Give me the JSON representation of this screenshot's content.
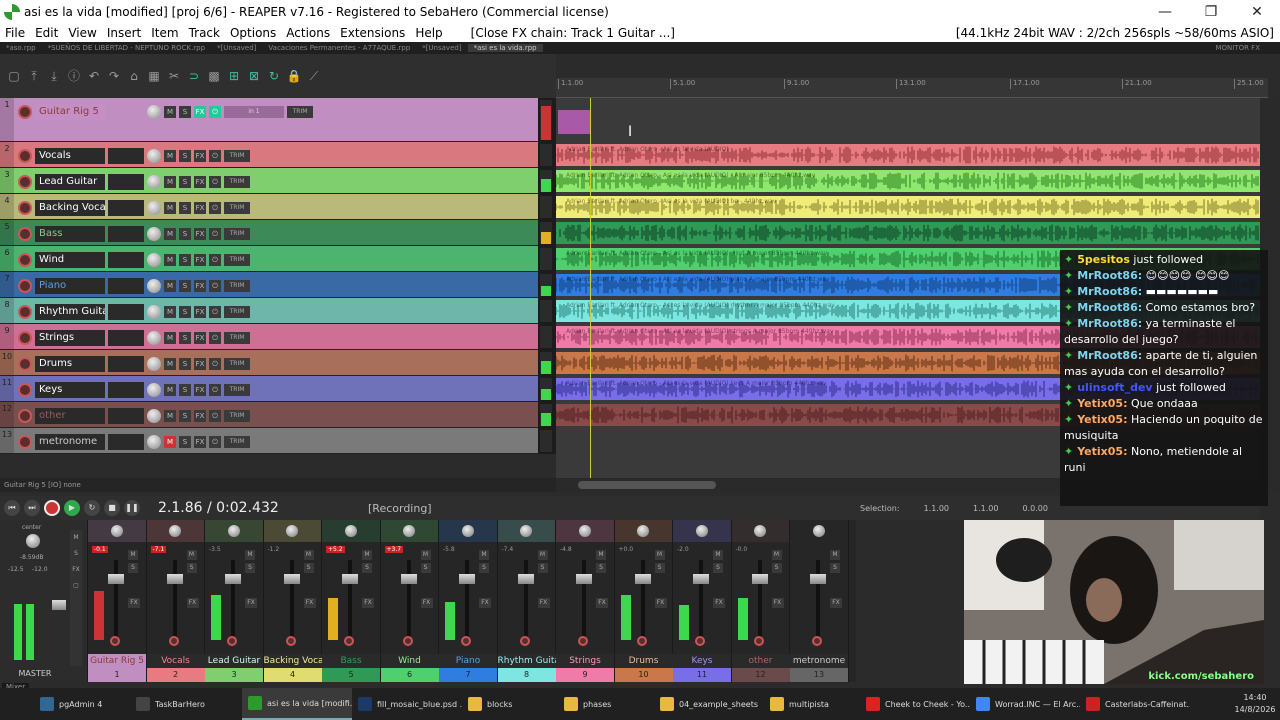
{
  "window": {
    "title": "asi es la vida [modified] [proj 6/6] - REAPER v7.16 - Registered to SebaHero (Commercial license)",
    "controls": [
      "—",
      "❐",
      "✕"
    ]
  },
  "menu": {
    "items": [
      "File",
      "Edit",
      "View",
      "Insert",
      "Item",
      "Track",
      "Options",
      "Actions",
      "Extensions",
      "Help"
    ],
    "fx_chain": "[Close FX chain: Track 1 Guitar ...]",
    "audio_info": "[44.1kHz 24bit WAV : 2/2ch 256spls ~58/60ms ASIO]"
  },
  "project_tabs": [
    "*aso.rpp",
    "*SUEÑOS DE LIBERTAD - NEPTUNO ROCK.rpp",
    "*[Unsaved]",
    "Vacaciones Permanentes - A77AQUE.rpp",
    "*[Unsaved]",
    "*asi es la vida.rpp"
  ],
  "monitor_fx": "MONITOR FX",
  "ruler": [
    "1.1.00",
    "5.1.00",
    "9.1.00",
    "13.1.00",
    "17.1.00",
    "21.1.00",
    "25.1.00"
  ],
  "tracks": [
    {
      "num": "1",
      "name": "Guitar Rig 5",
      "color": "#c08ec0",
      "text_color": "#8a3a3a",
      "input": "in 1",
      "meter": 0.85,
      "meter_color": "#c33"
    },
    {
      "num": "2",
      "name": "Vocals",
      "color": "#d9787e",
      "text_color": "#ffffff",
      "meter": 0.0,
      "meter_color": "#3cd94a"
    },
    {
      "num": "3",
      "name": "Lead Guitar",
      "color": "#7fcf6e",
      "text_color": "#ffffff",
      "meter": 0.6,
      "meter_color": "#3cd94a"
    },
    {
      "num": "4",
      "name": "Backing Vocals",
      "color": "#b9b97a",
      "text_color": "#ffffff",
      "meter": 0.0,
      "meter_color": "#3cd94a"
    },
    {
      "num": "5",
      "name": "Bass",
      "color": "#3c8a58",
      "text_color": "#7fcf8e",
      "meter": 0.55,
      "meter_color": "#e0b020"
    },
    {
      "num": "6",
      "name": "Wind",
      "color": "#4bb56f",
      "text_color": "#ffffff",
      "meter": 0.0,
      "meter_color": "#3cd94a"
    },
    {
      "num": "7",
      "name": "Piano",
      "color": "#3a6aa6",
      "text_color": "#5aa0e0",
      "meter": 0.45,
      "meter_color": "#3cd94a"
    },
    {
      "num": "8",
      "name": "Rhythm Guitar",
      "color": "#6fb6aa",
      "text_color": "#ffffff",
      "meter": 0.0,
      "meter_color": "#3cd94a"
    },
    {
      "num": "9",
      "name": "Strings",
      "color": "#cf6f94",
      "text_color": "#ffffff",
      "meter": 0.0,
      "meter_color": "#3cd94a"
    },
    {
      "num": "10",
      "name": "Drums",
      "color": "#a8705a",
      "text_color": "#ffffff",
      "meter": 0.6,
      "meter_color": "#3cd94a"
    },
    {
      "num": "11",
      "name": "Keys",
      "color": "#6f72b8",
      "text_color": "#ffffff",
      "meter": 0.5,
      "meter_color": "#3cd94a"
    },
    {
      "num": "12",
      "name": "other",
      "color": "#7a4f4f",
      "text_color": "#9a5a5a",
      "meter": 0.6,
      "meter_color": "#3cd94a"
    },
    {
      "num": "13",
      "name": "metronome",
      "color": "#7a7a7a",
      "text_color": "#cccccc",
      "meter": 0.0,
      "meter_color": "#3cd94a"
    }
  ],
  "items": [
    {
      "label": "Adrian Barilari ft. Adrian Otero - Asi es la vida (AUDIO)",
      "color": "#e87a82",
      "wave": "#8a2a30"
    },
    {
      "label": "Adrian Barilari ft. Adrian Otero - Asi es la vida (AUDIO) - A major 85bpm 440hz.wav",
      "color": "#8fe86e",
      "wave": "#2a7a1a"
    },
    {
      "label": "Adrian Barilari ft. Adrian Otero - Asi es la vida (AUDIO) bo - 440hz.wav",
      "color": "#f0ec7a",
      "wave": "#7a7020"
    },
    {
      "label": "",
      "color": "#2e9a55",
      "wave": "#0d3a20"
    },
    {
      "label": "Adrian Barilari ft. Adrian Otero - Asi es la vida (AUDIO) wind A major 85bpm 440hz.wav",
      "color": "#4fd06e",
      "wave": "#1a6a2a"
    },
    {
      "label": "Adrian Barilari ft. Adrian Otero - Asi es la vida (AUDIO) piano A major 85bpm 440hz.wav",
      "color": "#2f7de0",
      "wave": "#103a7a"
    },
    {
      "label": "Adrian Barilari ft. Adrian Otero - Asi es la vida (AUDIO) rhythm A major 85bpm 440hz.wav",
      "color": "#7ee6e0",
      "wave": "#207a74"
    },
    {
      "label": "Adrian Barilari ft. Adrian Otero - Asi es la vida (AUDIO) strings A major 85bpm 440hz.wav",
      "color": "#f07aa8",
      "wave": "#8a2a50"
    },
    {
      "label": "",
      "color": "#c8784a",
      "wave": "#5a2a10"
    },
    {
      "label": "Adrian Barilari ft. Adrian Otero - Asi es la vida (AUDIO) keys A major 85bpm 440hz.wav",
      "color": "#7a6ee8",
      "wave": "#2a2a8a"
    },
    {
      "label": "",
      "color": "#8a4a4a",
      "wave": "#4a1a1a"
    },
    {
      "label": "",
      "color": "#3a3a3a",
      "wave": "#3a3a3a"
    }
  ],
  "status_line": "Guitar Rig 5 [IO] none",
  "transport": {
    "position": "2.1.86 / 0:02.432",
    "status": "[Recording]"
  },
  "selection": {
    "label": "Selection:",
    "start": "1.1.00",
    "end": "1.1.00",
    "length": "0.0.00"
  },
  "mixer": {
    "master_label": "MASTER",
    "master_vol": "-8.59dB",
    "master_peaks": [
      "-12.5",
      "-12.0"
    ],
    "master_pan": "center",
    "panel_label": "Mixer",
    "strips": [
      {
        "name": "Guitar Rig 5",
        "num": "1",
        "vol": "-0.1",
        "peak_red": true,
        "meter": 0.7,
        "meter_color": "#c33",
        "label_color": "#c08ec0",
        "label_text": "#8a3a3a",
        "num_color": "#c08ec0"
      },
      {
        "name": "Vocals",
        "num": "2",
        "vol": "-7.1",
        "peak_red": true,
        "meter": 0.0,
        "meter_color": "#3cd94a",
        "label_color": "#2a2a2a",
        "label_text": "#e88",
        "num_color": "#e87a82"
      },
      {
        "name": "Lead Guitar",
        "num": "3",
        "vol": "-3.5",
        "peak_red": false,
        "meter": 0.65,
        "meter_color": "#3cd94a",
        "label_color": "#2a2a2a",
        "label_text": "#cfe",
        "num_color": "#7fcf6e"
      },
      {
        "name": "Backing Voca",
        "num": "4",
        "vol": "-1.2",
        "peak_red": false,
        "meter": 0.0,
        "meter_color": "#3cd94a",
        "label_color": "#2a2a2a",
        "label_text": "#ee9",
        "num_color": "#e0dc70"
      },
      {
        "name": "Bass",
        "num": "5",
        "vol": "+5.2",
        "peak_red": true,
        "meter": 0.6,
        "meter_color": "#e0b020",
        "label_color": "#2a2a2a",
        "label_text": "#3a9a5a",
        "num_color": "#2e9a55"
      },
      {
        "name": "Wind",
        "num": "6",
        "vol": "+3.7",
        "peak_red": true,
        "meter": 0.0,
        "meter_color": "#3cd94a",
        "label_color": "#2a2a2a",
        "label_text": "#9e9",
        "num_color": "#4fd06e"
      },
      {
        "name": "Piano",
        "num": "7",
        "vol": "-5.8",
        "peak_red": false,
        "meter": 0.55,
        "meter_color": "#3cd94a",
        "label_color": "#2a2a2a",
        "label_text": "#5aa0e0",
        "num_color": "#2f7de0"
      },
      {
        "name": "Rhythm Guita",
        "num": "8",
        "vol": "-7.4",
        "peak_red": false,
        "meter": 0.0,
        "meter_color": "#3cd94a",
        "label_color": "#2a2a2a",
        "label_text": "#9ee",
        "num_color": "#7ee6e0"
      },
      {
        "name": "Strings",
        "num": "9",
        "vol": "-4.8",
        "peak_red": false,
        "meter": 0.0,
        "meter_color": "#3cd94a",
        "label_color": "#2a2a2a",
        "label_text": "#f9b",
        "num_color": "#f07aa8"
      },
      {
        "name": "Drums",
        "num": "10",
        "vol": "+0.0",
        "peak_red": false,
        "meter": 0.65,
        "meter_color": "#3cd94a",
        "label_color": "#2a2a2a",
        "label_text": "#eb9",
        "num_color": "#c8784a"
      },
      {
        "name": "Keys",
        "num": "11",
        "vol": "-2.0",
        "peak_red": false,
        "meter": 0.5,
        "meter_color": "#3cd94a",
        "label_color": "#2a2a2a",
        "label_text": "#99e",
        "num_color": "#7a6ee8"
      },
      {
        "name": "other",
        "num": "12",
        "vol": "-0.0",
        "peak_red": false,
        "meter": 0.6,
        "meter_color": "#3cd94a",
        "label_color": "#2a2a2a",
        "label_text": "#a66",
        "num_color": "#6a4a4a"
      },
      {
        "name": "metronome",
        "num": "13",
        "vol": "",
        "peak_red": false,
        "meter": 0.0,
        "meter_color": "#3cd94a",
        "label_color": "#2a2a2a",
        "label_text": "#ccc",
        "num_color": "#666"
      }
    ]
  },
  "chat": [
    {
      "user": "5pesitos",
      "color": "#ffdd33",
      "text": " just followed"
    },
    {
      "user": "MrRoot86:",
      "color": "#7ed4f0",
      "text": " 😊😊😊😊 😊😊😊"
    },
    {
      "user": "MrRoot86:",
      "color": "#7ed4f0",
      "text": " ▬▬▬▬▬▬▬"
    },
    {
      "user": "MrRoot86:",
      "color": "#7ed4f0",
      "text": " Como estamos bro?"
    },
    {
      "user": "MrRoot86:",
      "color": "#7ed4f0",
      "text": " ya terminaste el desarrollo del juego?"
    },
    {
      "user": "MrRoot86:",
      "color": "#7ed4f0",
      "text": " aparte de ti, alguien mas ayuda con el desarrollo?"
    },
    {
      "user": "ulinsoft_dev",
      "color": "#4455ff",
      "text": " just followed"
    },
    {
      "user": "Yetix05:",
      "color": "#ffaa66",
      "text": " Que ondaaa"
    },
    {
      "user": "Yetix05:",
      "color": "#ffaa66",
      "text": " Haciendo un poquito de musiquita"
    },
    {
      "user": "Yetix05:",
      "color": "#ffaa66",
      "text": " Nono, metiendole al runi"
    }
  ],
  "webcam_url": "kick.com/sebahero",
  "taskbar": [
    {
      "label": "pgAdmin 4",
      "icon": "elephant-icon",
      "color": "#336791"
    },
    {
      "label": "TaskBarHero",
      "icon": "app-icon",
      "color": "#444"
    },
    {
      "label": "asi es la vida [modifi...",
      "icon": "reaper-icon",
      "color": "#2d9a2d",
      "active": true
    },
    {
      "label": "fill_mosaic_blue.psd ...",
      "icon": "photoshop-icon",
      "color": "#1b3a6a"
    },
    {
      "label": "blocks",
      "icon": "folder-icon",
      "color": "#e8b840"
    },
    {
      "label": "phases",
      "icon": "folder-icon",
      "color": "#e8b840"
    },
    {
      "label": "04_example_sheets",
      "icon": "folder-icon",
      "color": "#e8b840"
    },
    {
      "label": "multipista",
      "icon": "folder-icon",
      "color": "#e8b840"
    },
    {
      "label": "Cheek to Cheek - Yo...",
      "icon": "youtube-icon",
      "color": "#d22"
    },
    {
      "label": "Worrad.INC — El Arc...",
      "icon": "chrome-icon",
      "color": "#4285f4"
    },
    {
      "label": "Casterlabs-Caffeinat...",
      "icon": "casterlabs-icon",
      "color": "#c22"
    }
  ],
  "clock": {
    "time": "14:40",
    "date": "14/8/2026"
  }
}
